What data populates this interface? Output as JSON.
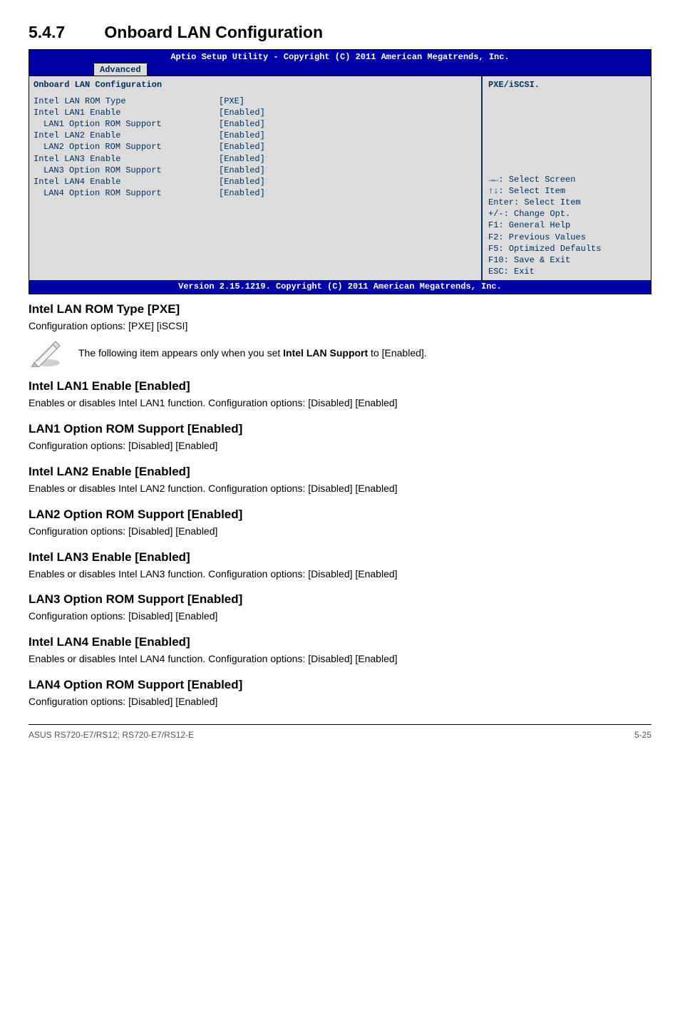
{
  "section": {
    "number": "5.4.7",
    "title": "Onboard LAN Configuration"
  },
  "bios": {
    "header": "Aptio Setup Utility - Copyright (C) 2011 American Megatrends, Inc.",
    "tab": "Advanced",
    "panel_title": "Onboard LAN Configuration",
    "rows": [
      {
        "label": "Intel LAN ROM Type",
        "value": "[PXE]",
        "indent": false
      },
      {
        "label": "Intel LAN1 Enable",
        "value": "[Enabled]",
        "indent": false
      },
      {
        "label": "LAN1 Option ROM Support",
        "value": "[Enabled]",
        "indent": true
      },
      {
        "label": "Intel LAN2 Enable",
        "value": "[Enabled]",
        "indent": false
      },
      {
        "label": "LAN2 Option ROM Support",
        "value": "[Enabled]",
        "indent": true
      },
      {
        "label": "Intel LAN3 Enable",
        "value": "[Enabled]",
        "indent": false
      },
      {
        "label": "LAN3 Option ROM Support",
        "value": "[Enabled]",
        "indent": true
      },
      {
        "label": "Intel LAN4 Enable",
        "value": "[Enabled]",
        "indent": false
      },
      {
        "label": "LAN4 Option ROM Support",
        "value": "[Enabled]",
        "indent": true
      }
    ],
    "help_top": "PXE/iSCSI.",
    "help_lines": [
      "→←: Select Screen",
      "↑↓:  Select Item",
      "Enter: Select Item",
      "+/-: Change Opt.",
      "F1: General Help",
      "F2: Previous Values",
      "F5: Optimized Defaults",
      "F10: Save & Exit",
      "ESC: Exit"
    ],
    "footer": "Version 2.15.1219. Copyright (C) 2011 American Megatrends, Inc."
  },
  "headings": {
    "h1": "Intel LAN ROM Type [PXE]",
    "h1_text": "Configuration options: [PXE] [iSCSI]",
    "note": "The following item appears only when you set Intel LAN Support to [Enabled].",
    "items": [
      {
        "title": "Intel LAN1 Enable [Enabled]",
        "text": "Enables or disables Intel LAN1 function. Configuration options: [Disabled] [Enabled]"
      },
      {
        "title": "LAN1 Option ROM Support [Enabled]",
        "text": "Configuration options: [Disabled] [Enabled]"
      },
      {
        "title": "Intel LAN2 Enable [Enabled]",
        "text": "Enables or disables Intel LAN2 function. Configuration options: [Disabled] [Enabled]"
      },
      {
        "title": "LAN2 Option ROM Support [Enabled]",
        "text": "Configuration options: [Disabled] [Enabled]"
      },
      {
        "title": "Intel LAN3 Enable [Enabled]",
        "text": "Enables or disables Intel LAN3 function. Configuration options: [Disabled] [Enabled]"
      },
      {
        "title": "LAN3 Option ROM Support [Enabled]",
        "text": "Configuration options: [Disabled] [Enabled]"
      },
      {
        "title": "Intel LAN4 Enable [Enabled]",
        "text": "Enables or disables Intel LAN4 function. Configuration options: [Disabled] [Enabled]"
      },
      {
        "title": "LAN4 Option ROM Support [Enabled]",
        "text": "Configuration options: [Disabled] [Enabled]"
      }
    ]
  },
  "footer": {
    "left": "ASUS RS720-E7/RS12; RS720-E7/RS12-E",
    "right": "5-25"
  }
}
